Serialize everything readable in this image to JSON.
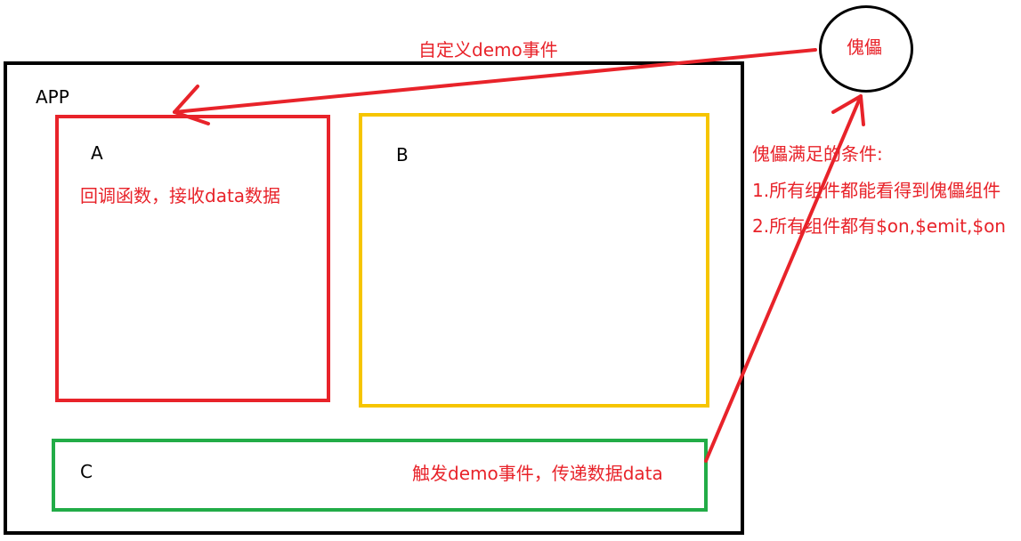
{
  "colors": {
    "frame": "#000000",
    "box_a": "#e8232a",
    "box_b": "#f6c500",
    "box_c": "#22ac47",
    "annotation": "#e8232a"
  },
  "app": {
    "label": "APP"
  },
  "box_a": {
    "label": "A",
    "note": "回调函数，接收data数据"
  },
  "box_b": {
    "label": "B"
  },
  "box_c": {
    "label": "C",
    "note": "触发demo事件，传递数据data"
  },
  "bus": {
    "label": "傀儡"
  },
  "arrow_top": {
    "label": "自定义demo事件"
  },
  "conditions": {
    "title": "傀儡满足的条件:",
    "items": [
      "1.所有组件都能看得到傀儡组件",
      "2.所有组件都有$on,$emit,$on"
    ]
  }
}
